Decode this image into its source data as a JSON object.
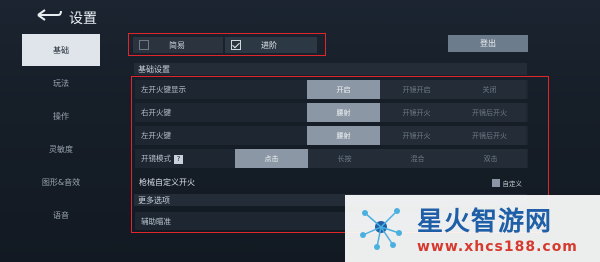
{
  "header": {
    "title": "设置"
  },
  "sidebar": {
    "items": [
      {
        "label": "基础",
        "active": true
      },
      {
        "label": "玩法",
        "active": false
      },
      {
        "label": "操作",
        "active": false
      },
      {
        "label": "灵敏度",
        "active": false
      },
      {
        "label": "图形&音效",
        "active": false
      },
      {
        "label": "语音",
        "active": false
      }
    ]
  },
  "mode": {
    "simple_label": "简易",
    "advanced_label": "进阶",
    "simple_checked": false,
    "advanced_checked": true
  },
  "logout_label": "登出",
  "basic_section": {
    "title": "基础设置"
  },
  "rows": [
    {
      "label": "左开火键显示",
      "options": [
        "开启",
        "开镜开启",
        "关闭"
      ],
      "selected": 0
    },
    {
      "label": "右开火键",
      "options": [
        "腰射",
        "开镜开火",
        "开镜后开火"
      ],
      "selected": 0
    },
    {
      "label": "左开火键",
      "options": [
        "腰射",
        "开镜开火",
        "开镜后开火"
      ],
      "selected": 0
    }
  ],
  "scope_mode": {
    "label": "开镜模式",
    "help_icon": "?",
    "options": [
      "点击",
      "长按",
      "混合",
      "双击"
    ],
    "selected": 0
  },
  "mech_fire": {
    "label": "枪械自定义开火",
    "custom_label": "自定义"
  },
  "more_section": {
    "title": "更多选项"
  },
  "assist_aim": {
    "label": "辅助瞄准"
  },
  "watermark": {
    "name": "星火智游网",
    "url": "www.xhcs188.com"
  },
  "colors": {
    "highlight_red": "#e0262b",
    "selected_option": "#8b97a4",
    "watermark_blue": "#1e5fa8",
    "watermark_red": "#d63a2f"
  }
}
